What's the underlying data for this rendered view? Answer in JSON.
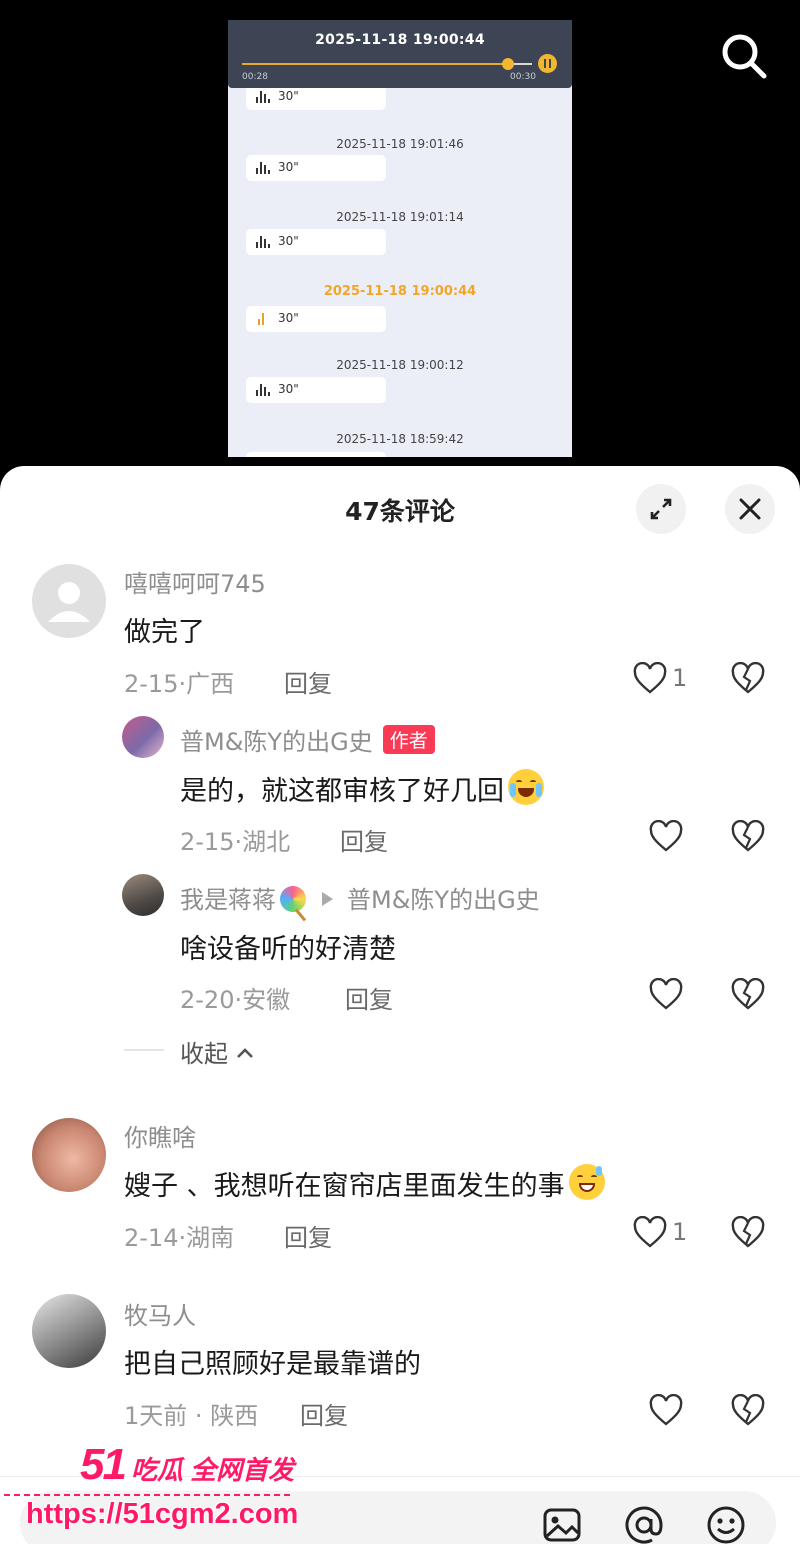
{
  "video": {
    "player": {
      "title_time": "2025-11-18 19:00:44",
      "current": "00:28",
      "total": "00:30",
      "progress": 0.93
    },
    "messages": [
      {
        "time": "",
        "duration": "30\""
      },
      {
        "time": "2025-11-18 19:01:46",
        "duration": "30\""
      },
      {
        "time": "2025-11-18 19:01:14",
        "duration": "30\""
      },
      {
        "time": "2025-11-18 19:00:44",
        "duration": "30\"",
        "highlighted": true
      },
      {
        "time": "2025-11-18 19:00:12",
        "duration": "30\""
      },
      {
        "time": "2025-11-18 18:59:42",
        "duration": ""
      }
    ]
  },
  "comments_panel": {
    "title": "47条评论",
    "comments": [
      {
        "user": "嘻嘻呵呵745",
        "text": "做完了",
        "date": "2-15",
        "location": "广西",
        "likes": "1"
      },
      {
        "user": "普M&陈Y的出G史",
        "badge": "作者",
        "text": "是的，就这都审核了好几回",
        "date": "2-15",
        "location": "湖北",
        "likes": ""
      },
      {
        "user": "我是蒋蒋",
        "reply_to": "普M&陈Y的出G史",
        "text": "啥设备听的好清楚",
        "date": "2-20",
        "location": "安徽",
        "likes": ""
      },
      {
        "user": "你瞧啥",
        "text": "嫂子 、我想听在窗帘店里面发生的事",
        "date": "2-14",
        "location": "湖南",
        "likes": "1"
      },
      {
        "user": "牧马人",
        "text": "把自己照顾好是最靠谱的",
        "date": "1天前",
        "location": "陕西",
        "likes": ""
      }
    ],
    "reply_label": "回复",
    "collapse_label": "收起",
    "meta_separator": "·"
  },
  "watermark": {
    "line1_num": "51",
    "line1_text": "吃瓜 全网首发",
    "url": "https://51cgm2.com"
  },
  "colors": {
    "author_badge": "#fb3b55",
    "highlight_time": "#f0a629",
    "watermark": "#ff1a66"
  },
  "icons": [
    "search-icon",
    "pause-icon",
    "voice-wave-icon",
    "expand-icon",
    "close-icon",
    "heart-icon",
    "broken-heart-icon",
    "image-icon",
    "at-icon",
    "emoji-icon"
  ]
}
